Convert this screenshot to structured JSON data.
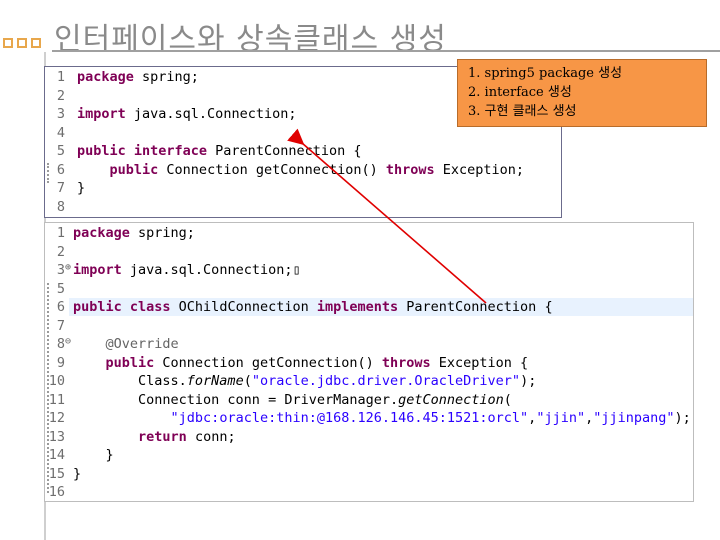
{
  "slide": {
    "title": "인터페이스와 상속클래스 생성"
  },
  "note": {
    "lines": [
      "1. spring5  package 생성",
      "2. interface 생성",
      "3. 구현 클래스 생성"
    ]
  },
  "colors": {
    "bullet": "#e8a74c",
    "note_bg": "#f79646",
    "arrow": "#e00000",
    "keyword": "#7f0055",
    "string": "#2a00ff"
  },
  "editor1": {
    "lines": [
      {
        "n": "1",
        "code": "package spring;"
      },
      {
        "n": "2",
        "code": ""
      },
      {
        "n": "3",
        "code": "import java.sql.Connection;"
      },
      {
        "n": "4",
        "code": ""
      },
      {
        "n": "5",
        "code": "public interface ParentConnection {"
      },
      {
        "n": "6",
        "code": "    public Connection getConnection() throws Exception;"
      },
      {
        "n": "7",
        "code": "}"
      },
      {
        "n": "8",
        "code": ""
      }
    ]
  },
  "editor2": {
    "lines": [
      {
        "n": "1",
        "code": "package spring;"
      },
      {
        "n": "2",
        "code": ""
      },
      {
        "n": "3",
        "code": "import java.sql.Connection;"
      },
      {
        "n": "5",
        "code": ""
      },
      {
        "n": "6",
        "code": "public class OChildConnection implements ParentConnection {"
      },
      {
        "n": "7",
        "code": ""
      },
      {
        "n": "8",
        "code": "    @Override"
      },
      {
        "n": "9",
        "code": "    public Connection getConnection() throws Exception {"
      },
      {
        "n": "10",
        "code": "        Class.forName(\"oracle.jdbc.driver.OracleDriver\");"
      },
      {
        "n": "11",
        "code": "        Connection conn = DriverManager.getConnection("
      },
      {
        "n": "12",
        "code": "            \"jdbc:oracle:thin:@168.126.146.45:1521:orcl\",\"jjin\",\"jjinpang\");"
      },
      {
        "n": "13",
        "code": "        return conn;"
      },
      {
        "n": "14",
        "code": "    }"
      },
      {
        "n": "15",
        "code": "}"
      },
      {
        "n": "16",
        "code": ""
      }
    ]
  }
}
